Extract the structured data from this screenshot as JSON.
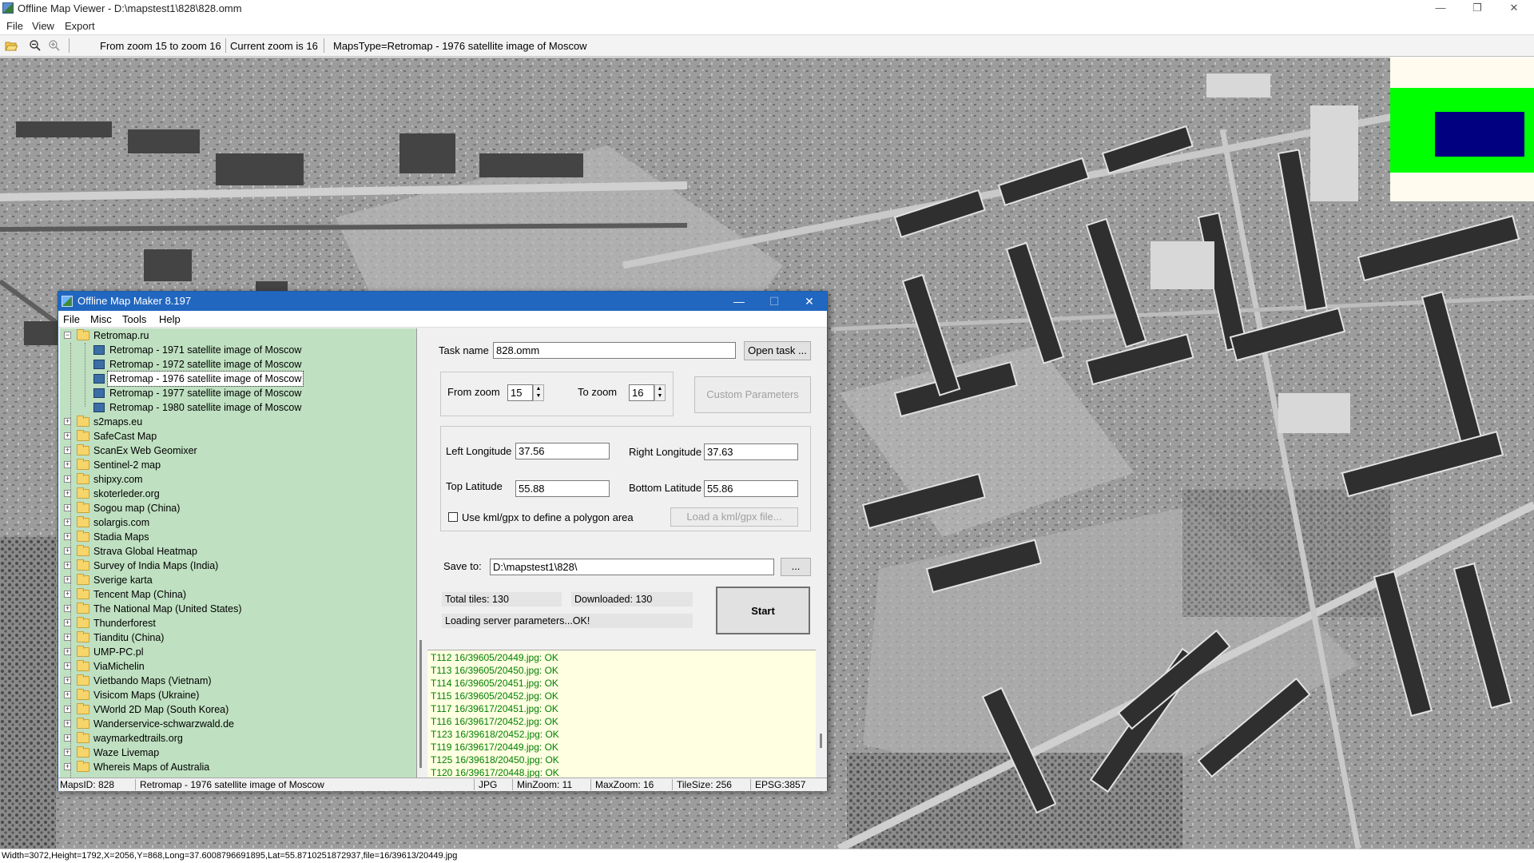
{
  "window": {
    "title": "Offline Map Viewer - D:\\mapstest1\\828\\828.omm",
    "menu": [
      "File",
      "View",
      "Export"
    ]
  },
  "toolbar": {
    "zoom_range": "From zoom 15 to zoom 16",
    "current_zoom": "Current zoom is 16",
    "maps_type": "MapsType=Retromap - 1976 satellite image of Moscow"
  },
  "statusbar": {
    "text": "Width=3072,Height=1792,X=2056,Y=868,Long=37.6008796691895,Lat=55.8710251872937,file=16/39613/20449.jpg"
  },
  "legend": {
    "background": "#fffbee",
    "outer_color": "#00ff00",
    "inner_color": "#000080"
  },
  "dialog": {
    "title": "Offline Map Maker 8.197",
    "menu": [
      "File",
      "Misc",
      "Tools",
      "Help"
    ],
    "tree": {
      "root": "Retromap.ru",
      "children": [
        "Retromap - 1971 satellite image of Moscow",
        "Retromap - 1972 satellite image of Moscow",
        "Retromap - 1976 satellite image of Moscow",
        "Retromap - 1977 satellite image of Moscow",
        "Retromap - 1980 satellite image of Moscow"
      ],
      "selected_index": 2,
      "providers": [
        "s2maps.eu",
        "SafeCast Map",
        "ScanEx Web Geomixer",
        "Sentinel-2 map",
        "shipxy.com",
        "skoterleder.org",
        "Sogou map (China)",
        "solargis.com",
        "Stadia Maps",
        "Strava Global Heatmap",
        "Survey of India Maps (India)",
        "Sverige karta",
        "Tencent Map (China)",
        "The National Map (United States)",
        "Thunderforest",
        "Tianditu (China)",
        "UMP-PC.pl",
        "ViaMichelin",
        "Vietbando Maps (Vietnam)",
        "Visicom Maps (Ukraine)",
        "VWorld 2D Map (South Korea)",
        "Wanderservice-schwarzwald.de",
        "waymarkedtrails.org",
        "Waze Livemap",
        "Whereis Maps of Australia"
      ]
    },
    "form": {
      "task_name_label": "Task name",
      "task_name_value": "828.omm",
      "open_task": "Open task ...",
      "from_zoom_label": "From zoom",
      "from_zoom_value": "15",
      "to_zoom_label": "To zoom",
      "to_zoom_value": "16",
      "custom_params": "Custom Parameters",
      "left_lon_label": "Left Longitude",
      "left_lon_value": "37.56",
      "right_lon_label": "Right Longitude",
      "right_lon_value": "37.63",
      "top_lat_label": "Top Latitude",
      "top_lat_value": "55.88",
      "bottom_lat_label": "Bottom Latitude",
      "bottom_lat_value": "55.86",
      "kml_label": "Use kml/gpx to define a polygon area",
      "kml_checked": false,
      "load_kml": "Load a kml/gpx file...",
      "save_to_label": "Save to:",
      "save_to_value": "D:\\mapstest1\\828\\",
      "browse": "...",
      "total_tiles": "Total tiles: 130",
      "downloaded": "Downloaded: 130",
      "loading": "Loading server parameters...OK!",
      "start": "Start"
    },
    "log": [
      "T112 16/39605/20449.jpg: OK",
      "T113 16/39605/20450.jpg: OK",
      "T114 16/39605/20451.jpg: OK",
      "T115 16/39605/20452.jpg: OK",
      "T117 16/39617/20451.jpg: OK",
      "T116 16/39617/20452.jpg: OK",
      "T123 16/39618/20452.jpg: OK",
      "T119 16/39617/20449.jpg: OK",
      "T125 16/39618/20450.jpg: OK",
      "T120 16/39617/20448.jpg: OK"
    ],
    "status": {
      "maps_id": "MapsID: 828",
      "map_name": "Retromap - 1976 satellite image of Moscow",
      "format": "JPG",
      "min_zoom": "MinZoom: 11",
      "max_zoom": "MaxZoom: 16",
      "tile_size": "TileSize: 256",
      "epsg": "EPSG:3857"
    }
  }
}
